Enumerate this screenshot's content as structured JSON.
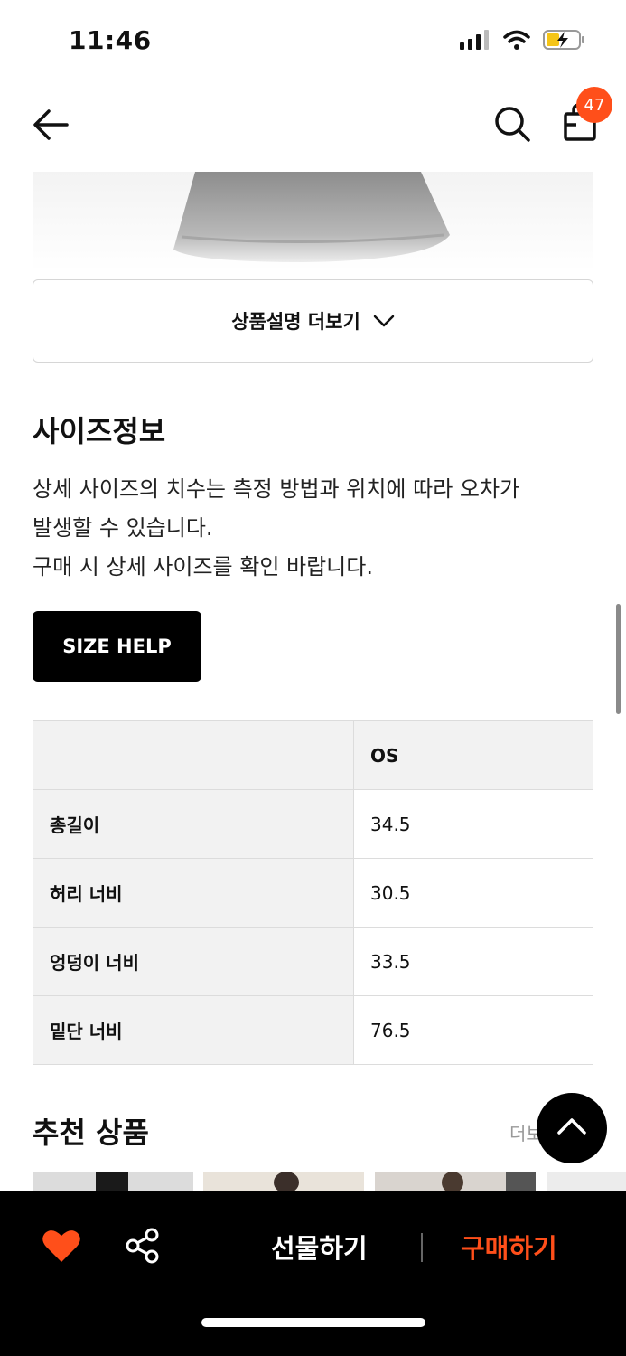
{
  "status_bar": {
    "time": "11:46",
    "icons": [
      "signal-icon",
      "wifi-icon",
      "battery-charging-icon"
    ]
  },
  "nav": {
    "back_icon": "arrow-left-icon",
    "search_icon": "search-icon",
    "bag_icon": "shopping-bag-icon",
    "cart_count": "47",
    "badge_color": "#ff4f1a"
  },
  "description": {
    "more_label": "상품설명 더보기"
  },
  "size_info": {
    "title": "사이즈정보",
    "desc_lines": [
      "상세 사이즈의 치수는 측정 방법과 위치에 따라 오차가",
      "발생할 수 있습니다.",
      "구매 시 상세 사이즈를 확인 바랍니다."
    ],
    "help_label": "SIZE HELP",
    "table": {
      "header": [
        "",
        "OS"
      ],
      "rows": [
        {
          "label": "총길이",
          "value": "34.5"
        },
        {
          "label": "허리 너비",
          "value": "30.5"
        },
        {
          "label": "엉덩이 너비",
          "value": "33.5"
        },
        {
          "label": "밑단 너비",
          "value": "76.5"
        }
      ]
    }
  },
  "recommend": {
    "title": "추천 상품",
    "more_label": "더보"
  },
  "actions": {
    "like_icon": "heart-icon",
    "share_icon": "share-icon",
    "gift_label": "선물하기",
    "buy_label": "구매하기",
    "accent": "#ff4f1a"
  }
}
